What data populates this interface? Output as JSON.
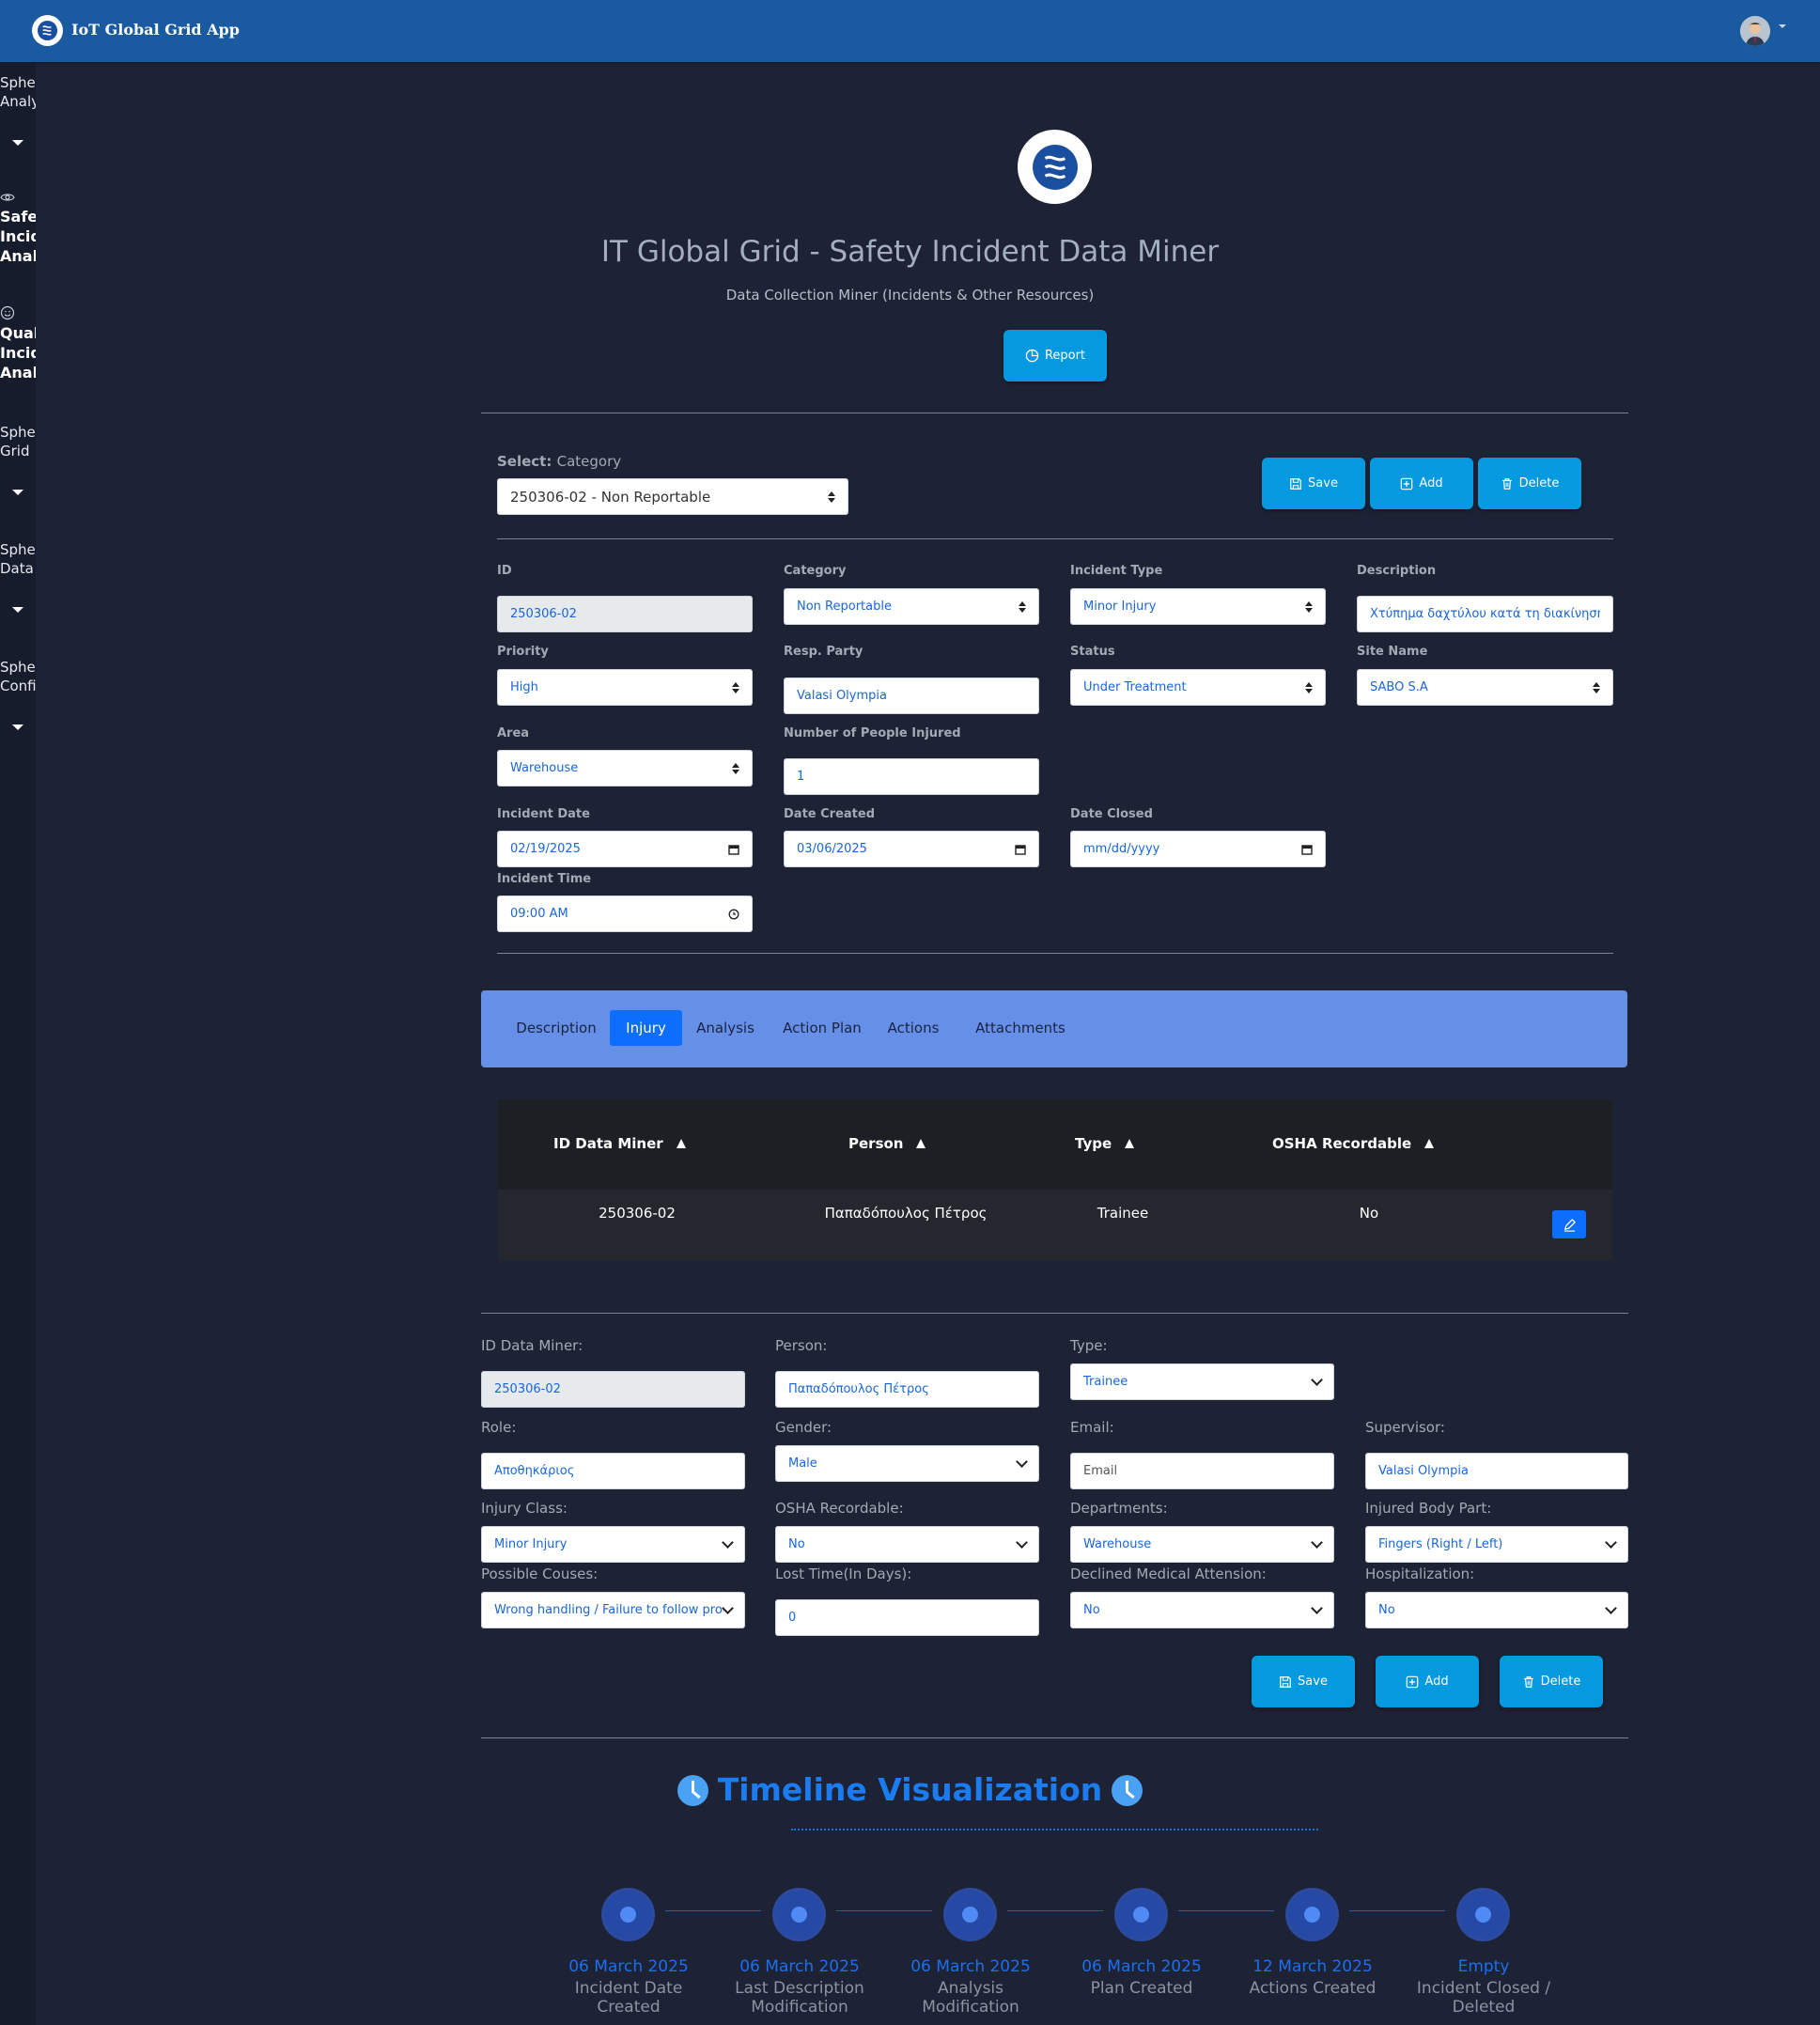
{
  "header": {
    "app_title": "IoT Global Grid App"
  },
  "sidebar": {
    "items": [
      {
        "label": "Sphere Analytics",
        "l1": "Sphe",
        "l2": "Analy",
        "icon": "caret-down-icon"
      },
      {
        "label": "Safety Incident Analysis",
        "l1": "Safet",
        "l2": "Incid",
        "l3": "Analy",
        "icon": "eye-icon"
      },
      {
        "label": "Quality Incident Analysis",
        "l1": "Qual",
        "l2": "Incid",
        "l3": "Analy",
        "icon": "smile-icon"
      },
      {
        "label": "Sphere Grid",
        "l1": "Sphe",
        "l2": "Grid",
        "icon": "caret-down-icon"
      },
      {
        "label": "Sphere Data",
        "l1": "Sphe",
        "l2": "Data",
        "icon": "caret-down-icon"
      },
      {
        "label": "Sphere Config",
        "l1": "Sphe",
        "l2": "Confi",
        "icon": "caret-down-icon"
      }
    ]
  },
  "page": {
    "title": "IT Global Grid - Safety Incident Data Miner",
    "subtitle": "Data Collection Miner (Incidents & Other Resources)",
    "report_label": "Report"
  },
  "selector": {
    "label_bold": "Select:",
    "label_rest": "Category",
    "value": "250306-02 - Non Reportable"
  },
  "actions": {
    "save": "Save",
    "add": "Add",
    "delete": "Delete"
  },
  "incident": {
    "id": {
      "label": "ID",
      "value": "250306-02"
    },
    "category": {
      "label": "Category",
      "value": "Non Reportable"
    },
    "incident_type": {
      "label": "Incident Type",
      "value": "Minor Injury"
    },
    "description": {
      "label": "Description",
      "value": "Χτύπημα δαχτύλου κατά τη διακίνηση φορτίου"
    },
    "priority": {
      "label": "Priority",
      "value": "High"
    },
    "resp_party": {
      "label": "Resp. Party",
      "value": "Valasi Olympia"
    },
    "status": {
      "label": "Status",
      "value": "Under Treatment"
    },
    "site_name": {
      "label": "Site Name",
      "value": "SABO S.A"
    },
    "area": {
      "label": "Area",
      "value": "Warehouse"
    },
    "people_injured": {
      "label": "Number of People Injured",
      "value": "1"
    },
    "incident_date": {
      "label": "Incident Date",
      "value": "02/19/2025"
    },
    "date_created": {
      "label": "Date Created",
      "value": "03/06/2025"
    },
    "date_closed": {
      "label": "Date Closed",
      "value": "mm/dd/yyyy"
    },
    "incident_time": {
      "label": "Incident Time",
      "value": "09:00 AM"
    }
  },
  "tabs": [
    {
      "label": "Description"
    },
    {
      "label": "Injury",
      "active": true
    },
    {
      "label": "Analysis"
    },
    {
      "label": "Action Plan"
    },
    {
      "label": "Actions"
    },
    {
      "label": "Attachments"
    }
  ],
  "injury_table": {
    "columns": [
      "ID Data Miner",
      "Person",
      "Type",
      "OSHA Recordable"
    ],
    "rows": [
      [
        "250306-02",
        "Παπαδόπουλος Πέτρος",
        "Trainee",
        "No"
      ]
    ]
  },
  "injury_form": {
    "id_data_miner": {
      "label": "ID Data Miner:",
      "value": "250306-02"
    },
    "person": {
      "label": "Person:",
      "value": "Παπαδόπουλος Πέτρος"
    },
    "type": {
      "label": "Type:",
      "value": "Trainee"
    },
    "role": {
      "label": "Role:",
      "value": "Αποθηκάριος"
    },
    "gender": {
      "label": "Gender:",
      "value": "Male"
    },
    "email": {
      "label": "Email:",
      "placeholder": "Email"
    },
    "supervisor": {
      "label": "Supervisor:",
      "value": "Valasi Olympia"
    },
    "injury_class": {
      "label": "Injury Class:",
      "value": "Minor Injury"
    },
    "osha": {
      "label": "OSHA Recordable:",
      "value": "No"
    },
    "departments": {
      "label": "Departments:",
      "value": "Warehouse"
    },
    "body_part": {
      "label": "Injured Body Part:",
      "value": "Fingers (Right / Left)"
    },
    "causes": {
      "label": "Possible Couses:",
      "value": "Wrong handling / Failure to follow procedure"
    },
    "lost_time": {
      "label": "Lost Time(In Days):",
      "value": "0"
    },
    "declined_medical": {
      "label": "Declined Medical Attension:",
      "value": "No"
    },
    "hospitalization": {
      "label": "Hospitalization:",
      "value": "No"
    }
  },
  "timeline": {
    "title": "Timeline Visualization",
    "events": [
      {
        "date": "06 March 2025",
        "caption": "Incident Date Created"
      },
      {
        "date": "06 March 2025",
        "caption": "Last Description Modification"
      },
      {
        "date": "06 March 2025",
        "caption": "Analysis Modification"
      },
      {
        "date": "06 March 2025",
        "caption": "Plan Created"
      },
      {
        "date": "12 March 2025",
        "caption": "Actions Created"
      },
      {
        "date": "Empty",
        "caption": "Incident Closed / Deleted"
      }
    ]
  },
  "colors": {
    "topbar": "#1a5aa0",
    "background": "#1d2234",
    "primary_button": "#0599df",
    "tab_bar": "#6690e8",
    "active_tab": "#0d6efd",
    "timeline_accent": "#1b7bf0"
  }
}
